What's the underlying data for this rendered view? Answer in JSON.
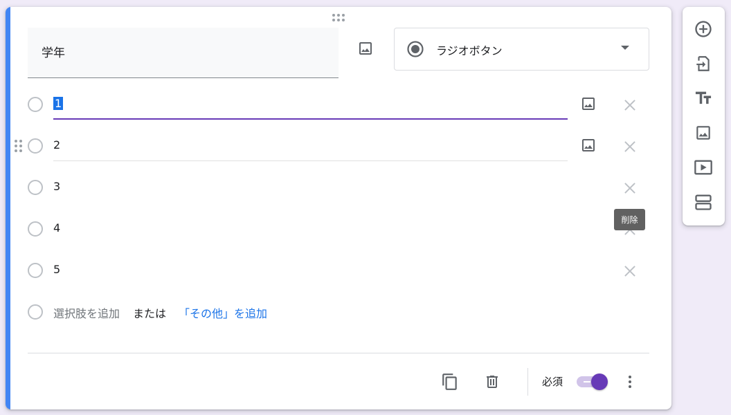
{
  "question": {
    "title": "学年",
    "type_select": {
      "selected": "ラジオボタン"
    },
    "options": [
      {
        "label": "1"
      },
      {
        "label": "2"
      },
      {
        "label": "3"
      },
      {
        "label": "4"
      },
      {
        "label": "5"
      }
    ],
    "add_option": "選択肢を追加",
    "or_text": "または",
    "add_other": "「その他」を追加"
  },
  "footer": {
    "required_label": "必須",
    "required_on": true
  },
  "tooltip": {
    "text": "削除"
  },
  "colors": {
    "accent": "#4285f4",
    "primary": "#673ab7",
    "link": "#1a73e8",
    "background": "#f0ebf8"
  },
  "icons": {
    "card_drag": "drag-handle-horizontal-icon",
    "title_image": "image-icon",
    "type_radio": "radio-checked-icon",
    "type_caret": "dropdown-caret-icon",
    "option_image": "image-icon",
    "option_delete": "close-icon",
    "option_drag": "drag-handle-vertical-icon",
    "duplicate": "copy-icon",
    "delete": "trash-icon",
    "more": "more-vert-icon",
    "side_toolbar": [
      "add-circle-icon",
      "import-question-icon",
      "title-text-icon",
      "add-image-icon",
      "add-video-icon",
      "add-section-icon"
    ]
  }
}
